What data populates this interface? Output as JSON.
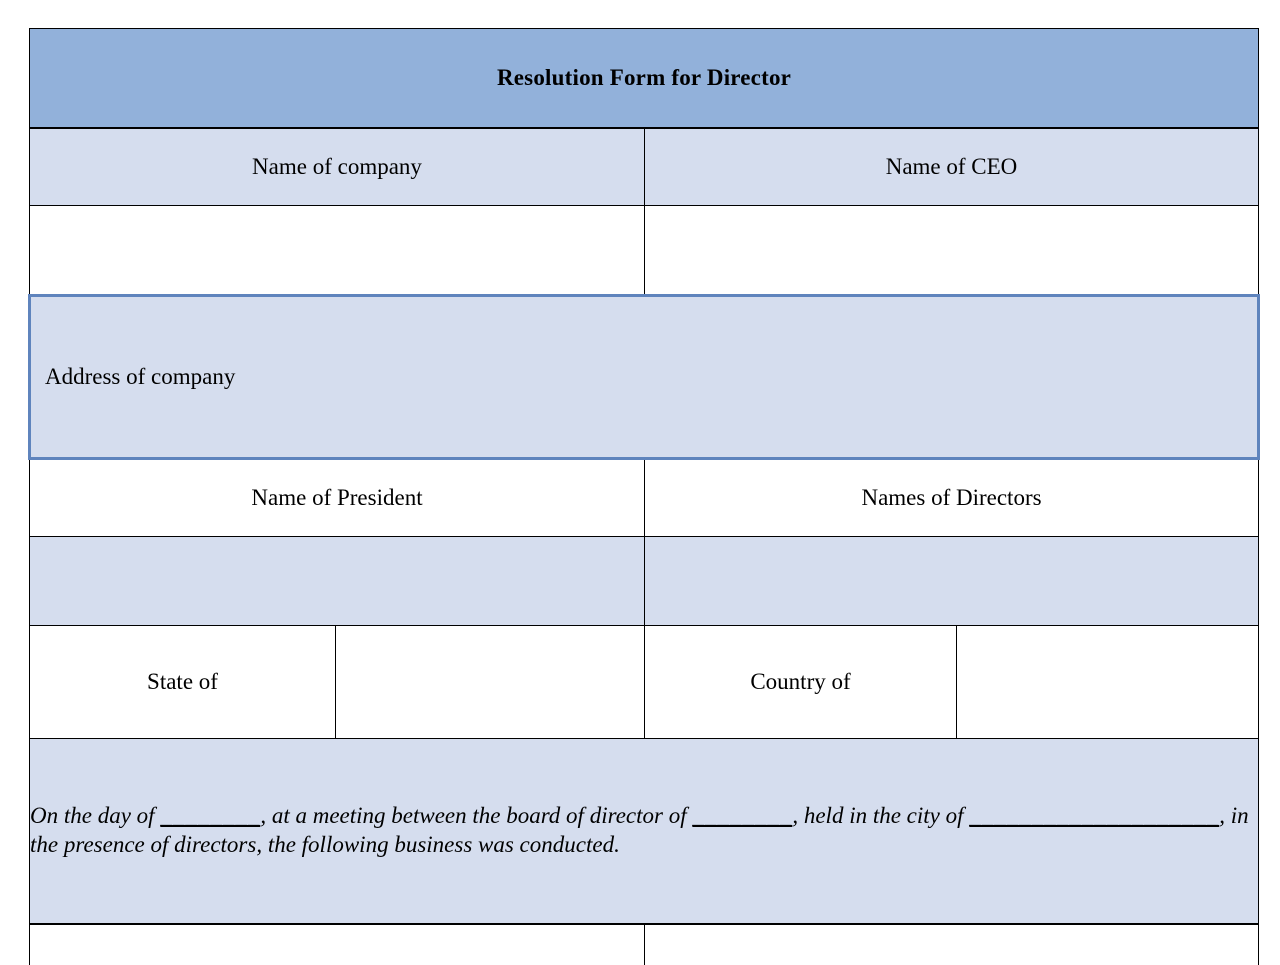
{
  "document": {
    "title": "Resolution Form for Director",
    "colors": {
      "title_header_blue": "#92b1da",
      "cell_fill_blue": "#d5ddee",
      "cell_fill_white": "#ffffff",
      "selection_border_blue": "#5f84bd",
      "grid_line": "#000000"
    }
  },
  "rows": {
    "company_block": {
      "label_left": "Name of company",
      "label_right": "Name of CEO",
      "value_left": "",
      "value_right": ""
    },
    "address_block": {
      "label": "Address of company",
      "value": ""
    },
    "officers_block": {
      "label_left": "Name of President",
      "label_right": "Names of Directors",
      "value_left": "",
      "value_right": ""
    },
    "location_block": {
      "label_state": "State of",
      "value_state": "",
      "label_country": "Country of",
      "value_country": ""
    },
    "resolution_paragraph": {
      "segment_1": "On the day of ",
      "blank_1": "________",
      "segment_2": ", at a meeting between the board of director of ",
      "blank_2": "________",
      "segment_3": ", held in the city of ",
      "blank_3": "____________________",
      "segment_4": ", in the presence of directors, the following business was conducted."
    },
    "next_block": {
      "value_left": "",
      "value_right": ""
    }
  }
}
